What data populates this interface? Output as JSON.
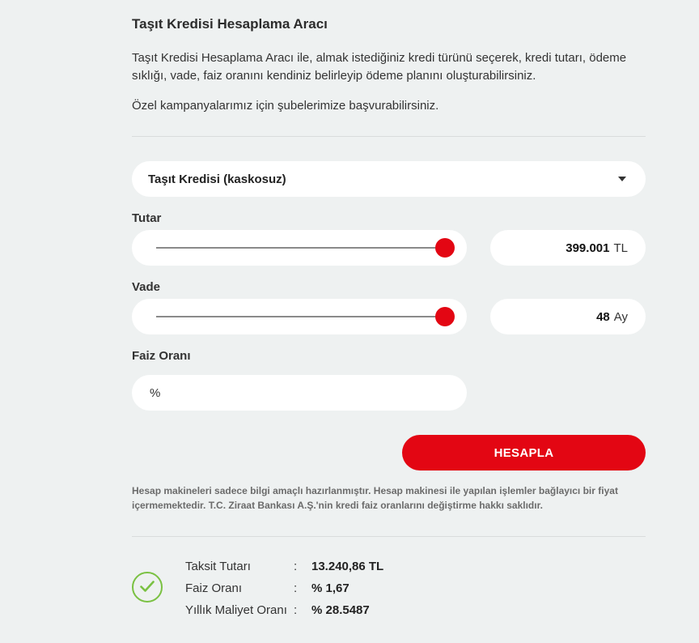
{
  "header": {
    "title": "Taşıt Kredisi Hesaplama Aracı",
    "description": "Taşıt Kredisi Hesaplama Aracı ile, almak istediğiniz kredi türünü seçerek, kredi tutarı, ödeme sıklığı, vade, faiz oranını kendiniz belirleyip ödeme planını oluşturabilirsiniz.",
    "note": "Özel kampanyalarımız için şubelerimize başvurabilirsiniz."
  },
  "form": {
    "credit_type": "Taşıt Kredisi (kaskosuz)",
    "tutar": {
      "label": "Tutar",
      "value": "399.001",
      "unit": "TL",
      "slider_fraction": 1.0
    },
    "vade": {
      "label": "Vade",
      "value": "48",
      "unit": "Ay",
      "slider_fraction": 1.0
    },
    "faiz": {
      "label": "Faiz Oranı",
      "placeholder": "%"
    },
    "button_label": "HESAPLA"
  },
  "disclaimer": "Hesap makineleri sadece bilgi amaçlı hazırlanmıştır. Hesap makinesi ile yapılan işlemler bağlayıcı bir fiyat içermemektedir. T.C. Ziraat Bankası A.Ş.'nin kredi faiz oranlarını değiştirme hakkı saklıdır.",
  "result": {
    "icon": "check-circle-icon",
    "separator": ":",
    "rows": [
      {
        "label": "Taksit Tutarı",
        "value": "13.240,86 TL"
      },
      {
        "label": "Faiz Oranı",
        "value": "% 1,67"
      },
      {
        "label": "Yıllık Maliyet Oranı",
        "value": "% 28.5487"
      }
    ]
  },
  "colors": {
    "accent": "#e30613",
    "success": "#7ac142",
    "background": "#eef1f1"
  }
}
